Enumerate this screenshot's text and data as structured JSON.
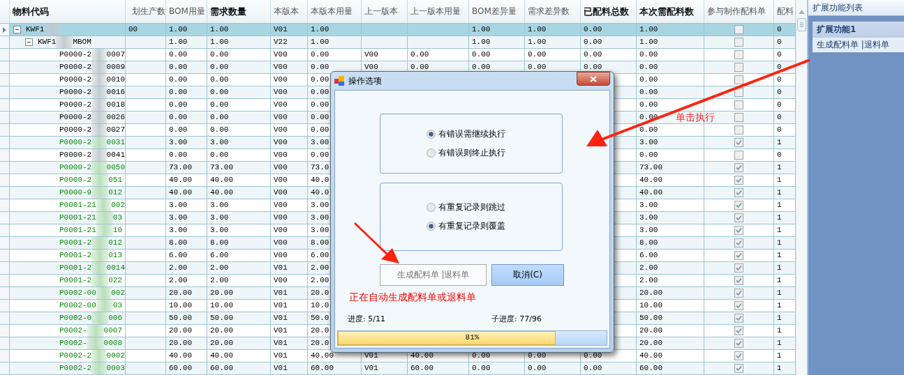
{
  "grid": {
    "columns": [
      {
        "label": "物料代码",
        "bold": true
      },
      {
        "label": "划生产数",
        "bold": false
      },
      {
        "label": "BOM用量",
        "bold": false
      },
      {
        "label": "需求数量",
        "bold": true
      },
      {
        "label": "本版本",
        "bold": false
      },
      {
        "label": "本版本用量",
        "bold": false
      },
      {
        "label": "上一版本",
        "bold": false
      },
      {
        "label": "上一版本用量",
        "bold": false
      },
      {
        "label": "BOM差异量",
        "bold": false
      },
      {
        "label": "需求差异数",
        "bold": false
      },
      {
        "label": "已配料总数",
        "bold": true
      },
      {
        "label": "本次需配料数",
        "bold": true
      },
      {
        "label": "参与制作配料单",
        "bold": false
      },
      {
        "label": "配料",
        "bold": false
      }
    ],
    "rows": [
      {
        "code_start": "KWF1",
        "selected": true,
        "expanded": true,
        "cells": {
          "plan_qty": "00",
          "bom_qty": "1.00",
          "demand_qty": "1.00",
          "version": "V01",
          "version_qty": "1.00",
          "bom_diff": "1.00",
          "demand_diff": "1.00",
          "allocated_total": "0.00",
          "this_alloc": "1.00"
        },
        "checked": false,
        "last": "0",
        "children": [
          {
            "code_start": "KWF1",
            "code_end": "MBOM",
            "selected": false,
            "expanded": true,
            "cells": {
              "bom_qty": "1.00",
              "demand_qty": "1.00",
              "version": "V22",
              "version_qty": "1.00",
              "bom_diff": "1.00",
              "demand_diff": "1.00",
              "allocated_total": "0.00",
              "this_alloc": "1.00"
            },
            "checked": false,
            "last": "0",
            "children": [
              {
                "code_start": "P0000-2",
                "code_end": "0007",
                "selected": false,
                "cells": {
                  "bom_qty": "0.00",
                  "demand_qty": "0.00",
                  "version": "V00",
                  "version_qty": "0.00",
                  "prev_version": "V00",
                  "prev_version_qty": "0.00",
                  "bom_diff": "0.00",
                  "demand_diff": "0.00",
                  "allocated_total": "0.00",
                  "this_alloc": "0.00"
                },
                "checked": false,
                "last": "0"
              },
              {
                "code_start": "P0000-2",
                "code_end": "0009",
                "selected": false,
                "cells": {
                  "bom_qty": "0.00",
                  "demand_qty": "0.00",
                  "version": "V00",
                  "version_qty": "0.00",
                  "prev_version": "V00",
                  "prev_version_qty": "0.00",
                  "bom_diff": "0.00",
                  "demand_diff": "0.00",
                  "allocated_total": "0.00",
                  "this_alloc": "0.00"
                },
                "checked": false,
                "last": "0"
              },
              {
                "code_start": "P0000-2",
                "code_end": "0010",
                "selected": false,
                "cells": {
                  "bom_qty": "0.00",
                  "demand_qty": "0.00",
                  "version": "V00",
                  "version_qty": "0.00",
                  "this_alloc": "0.00"
                },
                "checked": false,
                "last": "0"
              },
              {
                "code_start": "P0000-2",
                "code_end": "0016",
                "selected": false,
                "cells": {
                  "bom_qty": "0.00",
                  "demand_qty": "0.00",
                  "version": "V00",
                  "version_qty": "0.00",
                  "this_alloc": "0.00"
                },
                "checked": false,
                "last": "0"
              },
              {
                "code_start": "P0000-2",
                "code_end": "0018",
                "selected": false,
                "cells": {
                  "bom_qty": "0.00",
                  "demand_qty": "0.00",
                  "version": "V00",
                  "version_qty": "0.00",
                  "this_alloc": "0.00"
                },
                "checked": false,
                "last": "0"
              },
              {
                "code_start": "P0000-2",
                "code_end": "0026",
                "selected": false,
                "cells": {
                  "bom_qty": "0.00",
                  "demand_qty": "0.00",
                  "version": "V00",
                  "version_qty": "0.00",
                  "this_alloc": "0.00"
                },
                "checked": false,
                "last": "0"
              },
              {
                "code_start": "P0000-2",
                "code_end": "0027",
                "selected": false,
                "cells": {
                  "bom_qty": "0.00",
                  "demand_qty": "0.00",
                  "version": "V00",
                  "version_qty": "0.00",
                  "this_alloc": "0.00"
                },
                "checked": false,
                "last": "0"
              },
              {
                "code_start": "P0000-2",
                "code_end": "0031",
                "selected": false,
                "cells": {
                  "bom_qty": "3.00",
                  "demand_qty": "3.00",
                  "version": "V00",
                  "version_qty": "3.00",
                  "this_alloc": "3.00"
                },
                "checked": true,
                "last": "1"
              },
              {
                "code_start": "P0000-2",
                "code_end": "0041",
                "selected": false,
                "cells": {
                  "bom_qty": "0.00",
                  "demand_qty": "0.00",
                  "version": "V00",
                  "version_qty": "0.00",
                  "this_alloc": "0.00"
                },
                "checked": false,
                "last": "0"
              },
              {
                "code_start": "P0000-2",
                "code_end": "0050",
                "selected": false,
                "cells": {
                  "bom_qty": "73.00",
                  "demand_qty": "73.00",
                  "version": "V00",
                  "version_qty": "73.0",
                  "this_alloc": "73.00"
                },
                "checked": true,
                "last": "1"
              },
              {
                "code_start": "P0000-2",
                "code_end": "051",
                "selected": false,
                "cells": {
                  "bom_qty": "40.00",
                  "demand_qty": "40.00",
                  "version": "V00",
                  "version_qty": "40.0",
                  "this_alloc": "40.00"
                },
                "checked": true,
                "last": "1"
              },
              {
                "code_start": "P0000-9",
                "code_end": "012",
                "selected": false,
                "cells": {
                  "bom_qty": "40.00",
                  "demand_qty": "40.00",
                  "version": "V00",
                  "version_qty": "40.0",
                  "this_alloc": "40.00"
                },
                "checked": true,
                "last": "1"
              },
              {
                "code_start": "P0001-21",
                "code_end": "002",
                "selected": false,
                "cells": {
                  "bom_qty": "3.00",
                  "demand_qty": "3.00",
                  "version": "V00",
                  "version_qty": "3.00",
                  "this_alloc": "3.00"
                },
                "checked": true,
                "last": "1"
              },
              {
                "code_start": "P0001-21",
                "code_end": "03",
                "selected": false,
                "cells": {
                  "bom_qty": "3.00",
                  "demand_qty": "3.00",
                  "version": "V00",
                  "version_qty": "3.00",
                  "this_alloc": "3.00"
                },
                "checked": true,
                "last": "1"
              },
              {
                "code_start": "P0001-21",
                "code_end": "10",
                "selected": false,
                "cells": {
                  "bom_qty": "3.00",
                  "demand_qty": "3.00",
                  "version": "V00",
                  "version_qty": "3.00",
                  "this_alloc": "3.00"
                },
                "checked": true,
                "last": "1"
              },
              {
                "code_start": "P0001-2",
                "code_end": "012",
                "selected": false,
                "cells": {
                  "bom_qty": "8.00",
                  "demand_qty": "8.00",
                  "version": "V00",
                  "version_qty": "8.00",
                  "this_alloc": "8.00"
                },
                "checked": true,
                "last": "1"
              },
              {
                "code_start": "P0001-2",
                "code_end": "013",
                "selected": false,
                "cells": {
                  "bom_qty": "6.00",
                  "demand_qty": "6.00",
                  "version": "V00",
                  "version_qty": "6.00",
                  "this_alloc": "6.00"
                },
                "checked": true,
                "last": "1"
              },
              {
                "code_start": "P0001-2",
                "code_end": "0014",
                "selected": false,
                "cells": {
                  "bom_qty": "2.00",
                  "demand_qty": "2.00",
                  "version": "V01",
                  "version_qty": "2.00",
                  "this_alloc": "2.00"
                },
                "checked": true,
                "last": "1"
              },
              {
                "code_start": "P0001-2",
                "code_end": "022",
                "selected": false,
                "cells": {
                  "bom_qty": "2.00",
                  "demand_qty": "2.00",
                  "version": "V00",
                  "version_qty": "2.00",
                  "this_alloc": "2.00"
                },
                "checked": true,
                "last": "1"
              },
              {
                "code_start": "P0002-00",
                "code_end": "002",
                "selected": false,
                "cells": {
                  "bom_qty": "20.00",
                  "demand_qty": "20.00",
                  "version": "V01",
                  "version_qty": "20.0",
                  "this_alloc": "20.00"
                },
                "checked": true,
                "last": "1"
              },
              {
                "code_start": "P0002-00",
                "code_end": "03",
                "selected": false,
                "cells": {
                  "bom_qty": "10.00",
                  "demand_qty": "10.00",
                  "version": "V01",
                  "version_qty": "10.0",
                  "this_alloc": "10.00"
                },
                "checked": true,
                "last": "1"
              },
              {
                "code_start": "P0002-0",
                "code_end": "006",
                "selected": false,
                "cells": {
                  "bom_qty": "50.00",
                  "demand_qty": "50.00",
                  "version": "V01",
                  "version_qty": "50.0",
                  "this_alloc": "50.00"
                },
                "checked": true,
                "last": "1"
              },
              {
                "code_start": "P0002-",
                "code_end": "0007",
                "selected": false,
                "cells": {
                  "bom_qty": "20.00",
                  "demand_qty": "20.00",
                  "version": "V01",
                  "version_qty": "20.0",
                  "this_alloc": "20.00"
                },
                "checked": true,
                "last": "1"
              },
              {
                "code_start": "P0002-",
                "code_end": "0008",
                "selected": false,
                "cells": {
                  "bom_qty": "20.00",
                  "demand_qty": "20.00",
                  "version": "V01",
                  "version_qty": "20.0",
                  "this_alloc": "20.00"
                },
                "checked": true,
                "last": "1"
              },
              {
                "code_start": "P0002-2",
                "code_end": "0002",
                "selected": false,
                "cells": {
                  "bom_qty": "40.00",
                  "demand_qty": "40.00",
                  "version": "V01",
                  "version_qty": "40.00",
                  "prev_version": "V01",
                  "prev_version_qty": "40.00",
                  "bom_diff": "0.00",
                  "demand_diff": "0.00",
                  "allocated_total": "0.00",
                  "this_alloc": "40.00"
                },
                "checked": true,
                "last": "1"
              },
              {
                "code_start": "P0002-2",
                "code_end": "0003",
                "selected": false,
                "cells": {
                  "bom_qty": "60.00",
                  "demand_qty": "60.00",
                  "version": "V01",
                  "version_qty": "60.00",
                  "prev_version": "V01",
                  "prev_version_qty": "60.00",
                  "bom_diff": "0.00",
                  "demand_diff": "0.00",
                  "allocated_total": "0.00",
                  "this_alloc": "60.00"
                },
                "checked": true,
                "last": "1"
              }
            ]
          }
        ]
      }
    ]
  },
  "side_panel": {
    "title": "扩展功能列表",
    "group": "扩展功能1",
    "items": [
      {
        "label": "生成配料单 |退料单",
        "selected": true
      }
    ]
  },
  "dialog": {
    "title": "操作选项",
    "groups": [
      {
        "options": [
          {
            "label": "有错误需继续执行",
            "selected": true
          },
          {
            "label": "有错误则终止执行",
            "selected": false
          }
        ]
      },
      {
        "options": [
          {
            "label": "有重复记录则跳过",
            "selected": false
          },
          {
            "label": "有重复记录则覆盖",
            "selected": true
          }
        ]
      }
    ],
    "buttons": [
      {
        "label": "生成配料单 |退料单",
        "disabled": true
      },
      {
        "label": "取消(C)",
        "disabled": false
      }
    ],
    "status": "正在自动生成配料单或退料单",
    "progress_label": "进度: 5/11",
    "sub_progress_label": "子进度: 77/96",
    "progress": {
      "level": 0.81,
      "text": "81%"
    }
  },
  "annotation": {
    "text": "单击执行"
  }
}
